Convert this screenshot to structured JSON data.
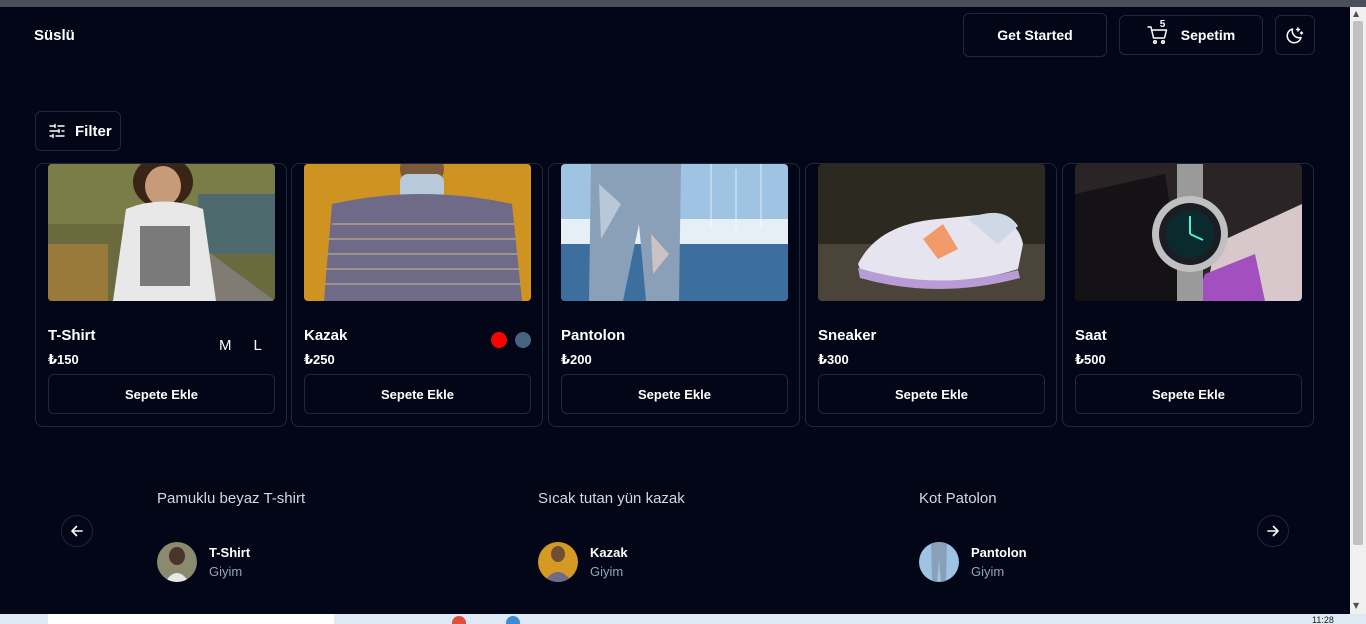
{
  "header": {
    "brand": "Süslü",
    "get_started_label": "Get Started",
    "cart_label": "Sepetim",
    "cart_count": "5"
  },
  "filter": {
    "label": "Filter"
  },
  "products": [
    {
      "name": "T-Shirt",
      "price": "₺150",
      "add_label": "Sepete Ekle",
      "sizes": [
        "M",
        "L"
      ]
    },
    {
      "name": "Kazak",
      "price": "₺250",
      "add_label": "Sepete Ekle",
      "colors": [
        "#ff0000",
        "#4a6380"
      ]
    },
    {
      "name": "Pantolon",
      "price": "₺200",
      "add_label": "Sepete Ekle"
    },
    {
      "name": "Sneaker",
      "price": "₺300",
      "add_label": "Sepete Ekle"
    },
    {
      "name": "Saat",
      "price": "₺500",
      "add_label": "Sepete Ekle"
    }
  ],
  "reviews": [
    {
      "quote": "Pamuklu beyaz T-shirt",
      "name": "T-Shirt",
      "category": "Giyim"
    },
    {
      "quote": "Sıcak tutan yün kazak",
      "name": "Kazak",
      "category": "Giyim"
    },
    {
      "quote": "Kot Patolon",
      "name": "Pantolon",
      "category": "Giyim"
    }
  ],
  "taskbar": {
    "time": "11:28"
  },
  "icons": {
    "filter": "sliders-icon",
    "cart": "shopping-cart-icon",
    "theme": "moon-sparkles-icon",
    "prev": "arrow-left-icon",
    "next": "arrow-right-icon"
  }
}
